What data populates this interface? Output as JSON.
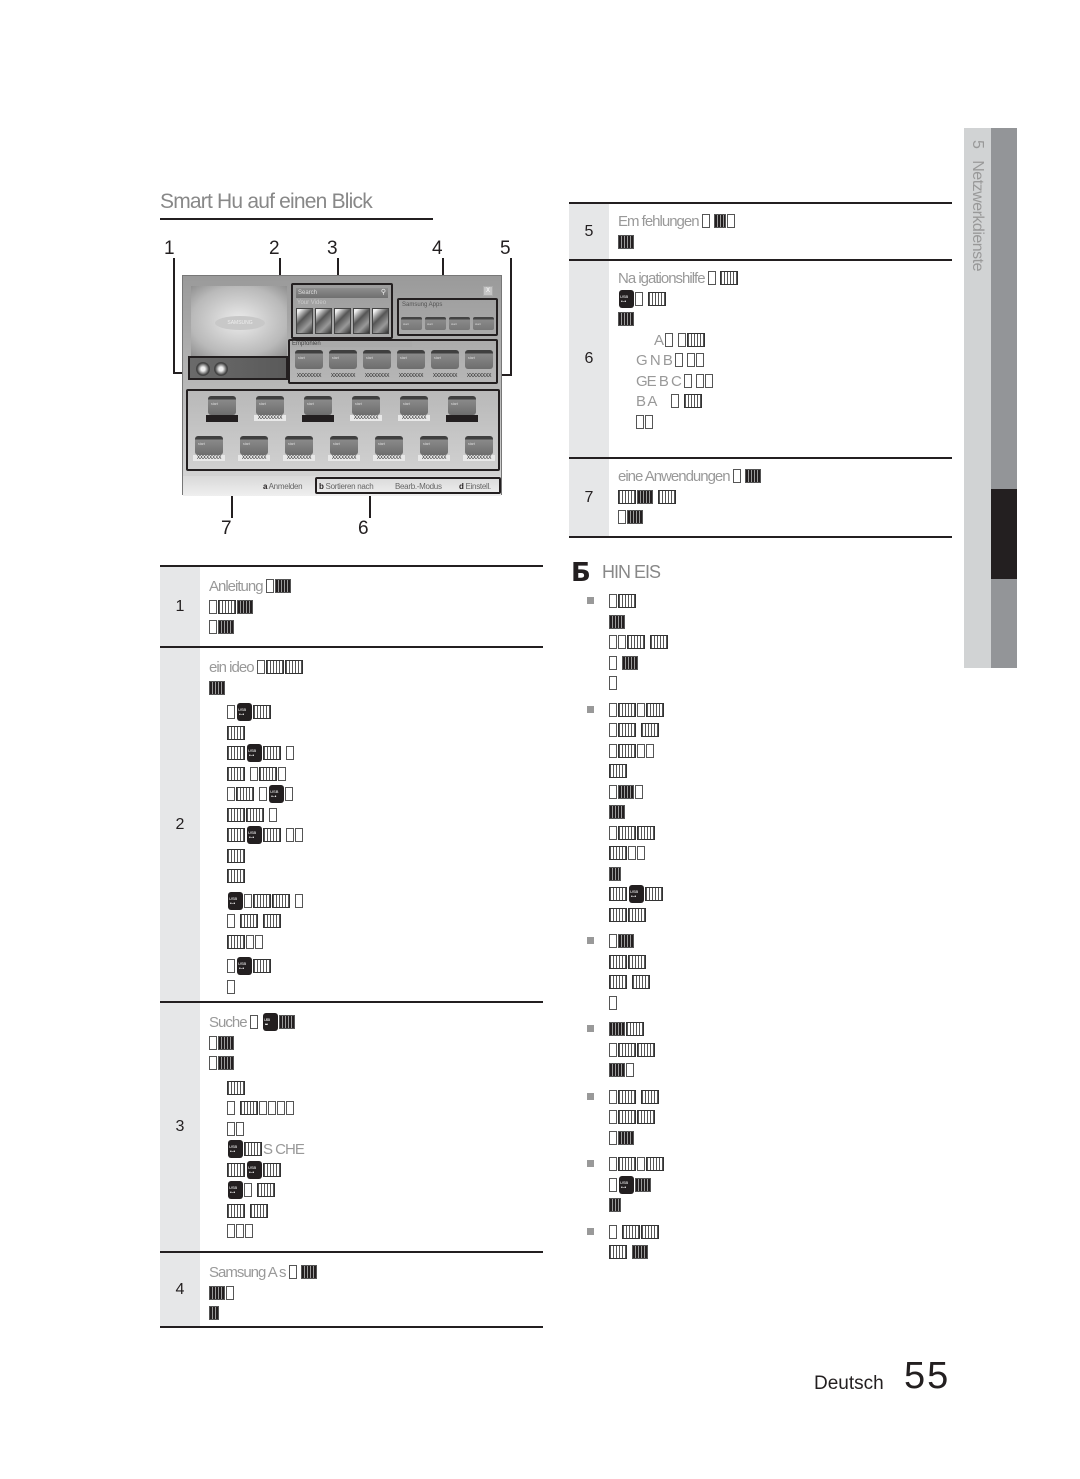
{
  "page": {
    "title": "Smart Hu  auf einen Blick",
    "language": "Deutsch",
    "page_number": "55",
    "chapter_number": "5",
    "chapter_title": "Netzwerkdienste"
  },
  "illustration": {
    "callouts": [
      "1",
      "2",
      "3",
      "4",
      "5",
      "6",
      "7"
    ],
    "search_placeholder": "Search",
    "search_icon": "magnifier-icon",
    "close_label": "X",
    "samsung_logo": "SAMSUNG",
    "your_video_label": "Your Video",
    "samsung_apps_label": "Samsung Apps",
    "recommended_label": "Empfohlen",
    "tile_label": "start",
    "tile_caption": "XXXXXXXX",
    "bottom_bar": [
      {
        "key": "a",
        "label": "Anmelden"
      },
      {
        "key": "b",
        "label": "Sortieren nach"
      },
      {
        "key": "",
        "label": "Bearb.-Modus"
      },
      {
        "key": "d",
        "label": "Einstell."
      }
    ]
  },
  "left_table": [
    {
      "num": "1",
      "heading": "Anleitung"
    },
    {
      "num": "2",
      "heading": "ein  ideo"
    },
    {
      "num": "3",
      "heading": "Suche",
      "extra": "S CHE"
    },
    {
      "num": "4",
      "heading": "Samsung A  s"
    }
  ],
  "right_table": [
    {
      "num": "5",
      "heading": "Em fehlungen"
    },
    {
      "num": "6",
      "heading": "Na igationshilfe",
      "sub": [
        "A",
        "G  N  B",
        "GE B  C",
        "B A"
      ]
    },
    {
      "num": "7",
      "heading": "eine Anwendungen"
    }
  ],
  "note": {
    "icon": "Б",
    "title": "HIN EIS"
  }
}
